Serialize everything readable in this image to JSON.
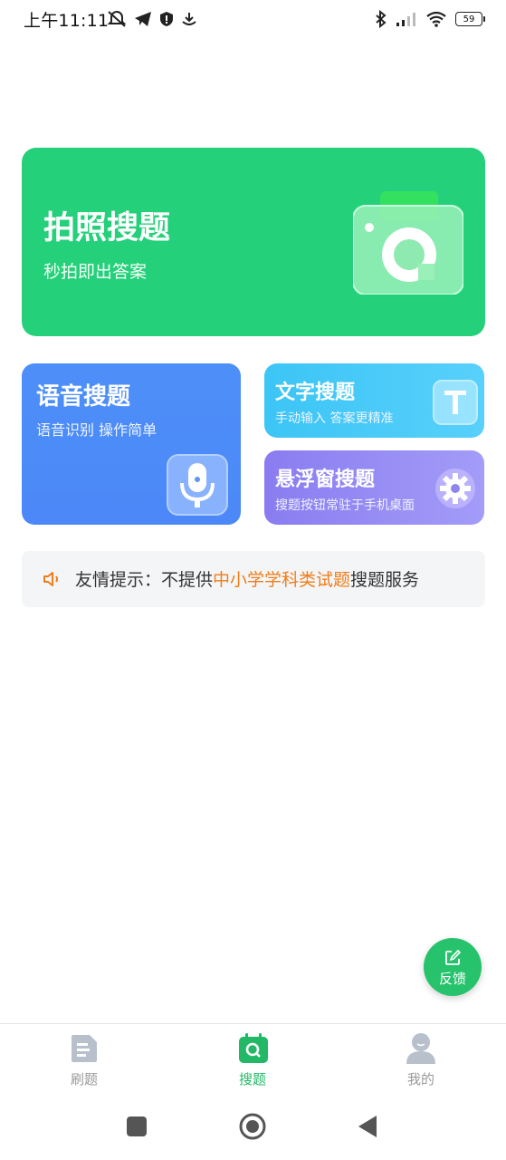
{
  "status_bar": {
    "time": "上午11:11",
    "battery": "59"
  },
  "photo_search": {
    "title": "拍照搜题",
    "subtitle": "秒拍即出答案"
  },
  "voice_search": {
    "title": "语音搜题",
    "subtitle": "语音识别 操作简单"
  },
  "text_search": {
    "title": "文字搜题",
    "subtitle": "手动输入 答案更精准"
  },
  "float_search": {
    "title": "悬浮窗搜题",
    "subtitle": "搜题按钮常驻于手机桌面"
  },
  "notice": {
    "prefix": "友情提示：不提供",
    "highlight": "中小学学科类试题",
    "suffix": "搜题服务"
  },
  "feedback": {
    "label": "反馈"
  },
  "tabs": [
    {
      "label": "刷题",
      "icon": "document-icon"
    },
    {
      "label": "搜题",
      "icon": "search-calendar-icon"
    },
    {
      "label": "我的",
      "icon": "user-icon"
    }
  ],
  "colors": {
    "accent": "#25d07a",
    "highlight": "#f07d1a",
    "voice": "#4c8af8",
    "text": "#4ac9f8",
    "float": "#9589f4"
  }
}
